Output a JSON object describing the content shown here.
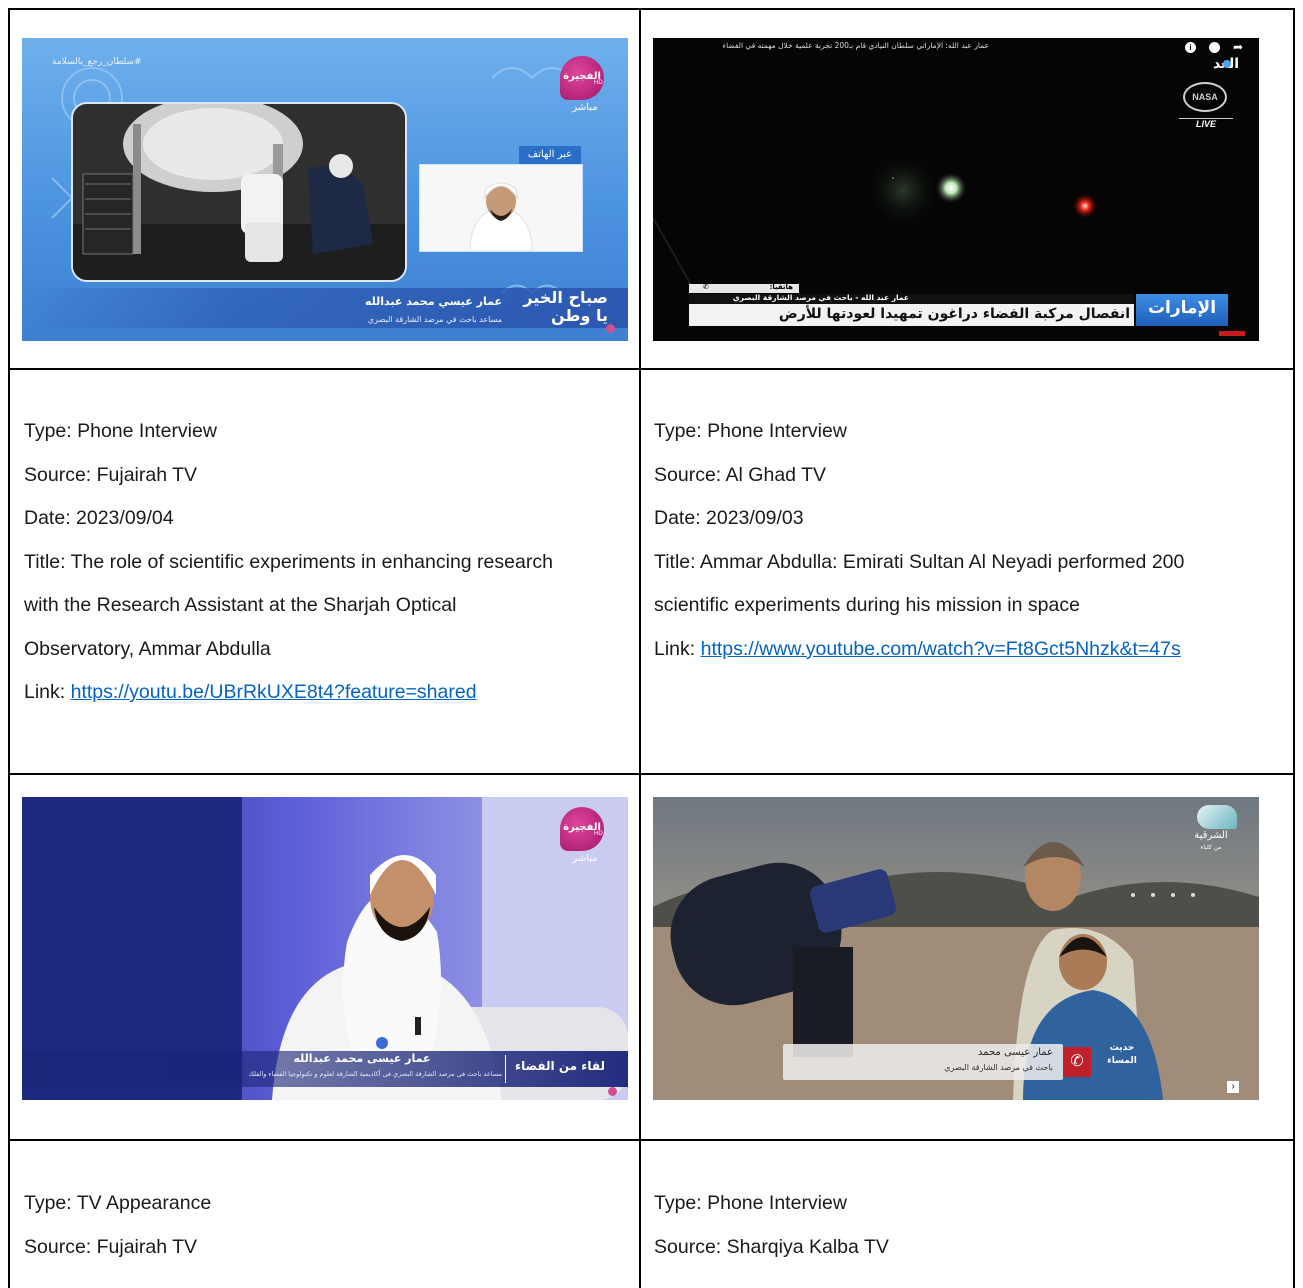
{
  "entries": [
    {
      "type": "Type: Phone Interview",
      "source": "Source: Fujairah TV",
      "date": "Date: 2023/09/04",
      "title_l1": "Title: The role of scientific experiments in enhancing research",
      "title_l2": "with the Research Assistant at the Sharjah Optical",
      "title_l3": "Observatory, Ammar Abdulla",
      "link_label": "Link: ",
      "link": "https://youtu.be/UBrRkUXE8t4?feature=shared",
      "thumb": {
        "hashtag": "#سلطان_رجع_بالسلامة",
        "channel": "الفجيرة",
        "hd": "HD",
        "live": "مباشر",
        "by_phone": "عبر الهاتف",
        "show_l1": "صباح الخير",
        "show_l2": "يا وطن",
        "guest_name": "عمار عيسي محمد عبدالله",
        "guest_title": "مساعد باحث في مرصد الشارقة البصري"
      }
    },
    {
      "type": "Type: Phone Interview",
      "source": "Source: Al Ghad TV",
      "date": "Date: 2023/09/03",
      "title_l1": "Title: Ammar Abdulla: Emirati Sultan Al Neyadi performed 200",
      "title_l2": "scientific experiments during his mission in space",
      "link_label": "Link: ",
      "link": "https://www.youtube.com/watch?v=Ft8Gct5Nhzk&t=47s",
      "thumb": {
        "top_caption": "عمار عبد الله: الإماراتي سلطان النيادي قام بـ200 تجربة علمية خلال مهمته في الفضاء",
        "channel": "الغد",
        "nasa": "NASA",
        "live": "LIVE",
        "phone_label": "هاتفيا:",
        "guest_line": "عمار عبد الله - باحث في مرصد الشارقة البصري",
        "headline": "انفصال مركبة الفضاء دراغون تمهيدا لعودتها للأرض",
        "region": "الإمارات"
      }
    },
    {
      "type": "Type: TV Appearance",
      "source": "Source: Fujairah TV",
      "thumb": {
        "channel": "الفجيرة",
        "hd": "HD",
        "live": "مباشر",
        "segment": "لقاء من الفضاء",
        "guest_name": "عمار عيسى محمد عبدالله",
        "guest_title": "مساعد باحث في مرصد الشارقة البصري في أكاديمية الشارقة لعلوم و تكنولوجيا الفضاء والفلك"
      }
    },
    {
      "type": "Type: Phone Interview",
      "source": "Source: Sharqiya Kalba TV",
      "thumb": {
        "channel": "الشرقية",
        "channel_sub": "من كلباء",
        "guest_name": "عمار عيسى محمد",
        "guest_title": "باحث في مرصد الشارقة البصري",
        "program": "حديث المساء"
      }
    }
  ],
  "colors": {
    "link": "#0563c1",
    "border": "#000000"
  }
}
